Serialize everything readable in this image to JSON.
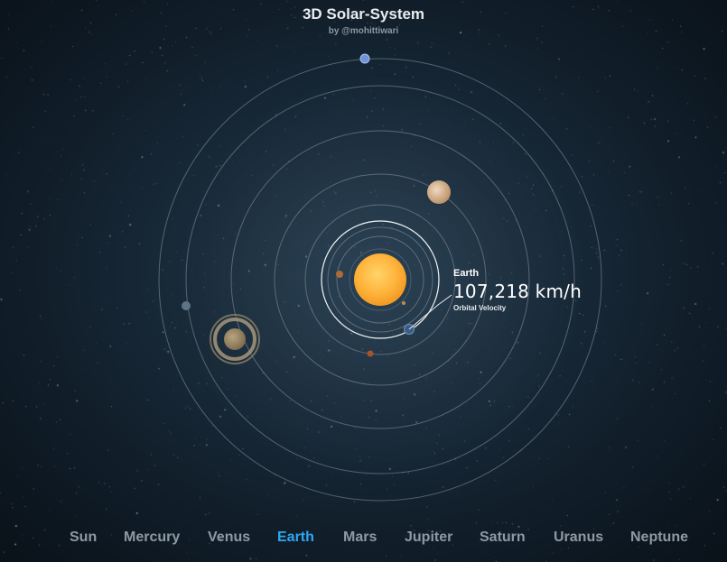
{
  "header": {
    "title": "3D Solar-System",
    "byline": "by @mohittiwari"
  },
  "info": {
    "planet_name": "Earth",
    "velocity": "107,218 km/h",
    "velocity_label": "Orbital Velocity"
  },
  "nav": {
    "items": [
      {
        "label": "Sun",
        "active": false
      },
      {
        "label": "Mercury",
        "active": false
      },
      {
        "label": "Venus",
        "active": false
      },
      {
        "label": "Earth",
        "active": true
      },
      {
        "label": "Mars",
        "active": false
      },
      {
        "label": "Jupiter",
        "active": false
      },
      {
        "label": "Saturn",
        "active": false
      },
      {
        "label": "Uranus",
        "active": false
      },
      {
        "label": "Neptune",
        "active": false
      }
    ]
  },
  "colors": {
    "accent": "#2ea7f0",
    "sun": "#ffb13b",
    "orbit": "#8a98a4"
  }
}
